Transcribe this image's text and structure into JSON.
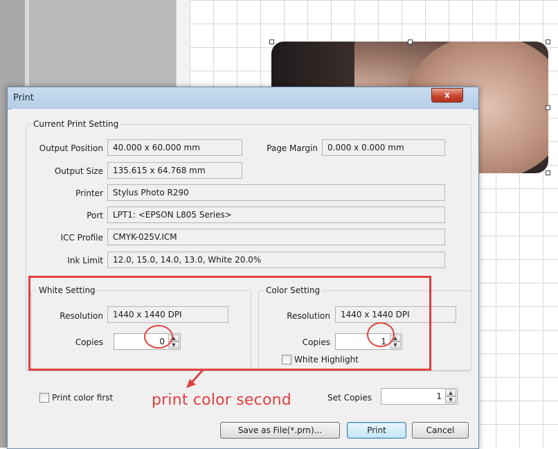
{
  "dialog": {
    "title": "Print",
    "close_label": "x"
  },
  "current_setting": {
    "group_label": "Current Print Setting",
    "output_position": {
      "label": "Output Position",
      "value": "40.000 x 60.000 mm"
    },
    "page_margin": {
      "label": "Page Margin",
      "value": "0.000 x 0.000 mm"
    },
    "output_size": {
      "label": "Output Size",
      "value": "135.615 x 64.768 mm"
    },
    "printer": {
      "label": "Printer",
      "value": "Stylus Photo R290"
    },
    "port": {
      "label": "Port",
      "value": "LPT1:  <EPSON L805 Series>"
    },
    "icc_profile": {
      "label": "ICC Profile",
      "value": "CMYK-025V.ICM"
    },
    "ink_limit": {
      "label": "Ink Limit",
      "value": "12.0, 15.0, 14.0, 13.0, White 20.0%"
    }
  },
  "white_setting": {
    "group_label": "White Setting",
    "resolution_label": "Resolution",
    "resolution_value": "1440 x 1440 DPI",
    "copies_label": "Copies",
    "copies_value": "0"
  },
  "color_setting": {
    "group_label": "Color Setting",
    "resolution_label": "Resolution",
    "resolution_value": "1440 x 1440 DPI",
    "copies_label": "Copies",
    "copies_value": "1",
    "white_highlight_label": "White Highlight"
  },
  "footer": {
    "print_color_first_label": "Print color first",
    "set_copies_label": "Set Copies",
    "set_copies_value": "1",
    "save_file_label": "Save as File(*.prn)...",
    "print_label": "Print",
    "cancel_label": "Cancel"
  },
  "annotation": {
    "text": "print color second",
    "color": "#e0403f"
  },
  "colors": {
    "titlebar": "#c9dcef",
    "dialog_bg": "#f0f0f0",
    "close_button": "#c7452f"
  },
  "icons": {
    "spin_up": "▲",
    "spin_down": "▼"
  }
}
